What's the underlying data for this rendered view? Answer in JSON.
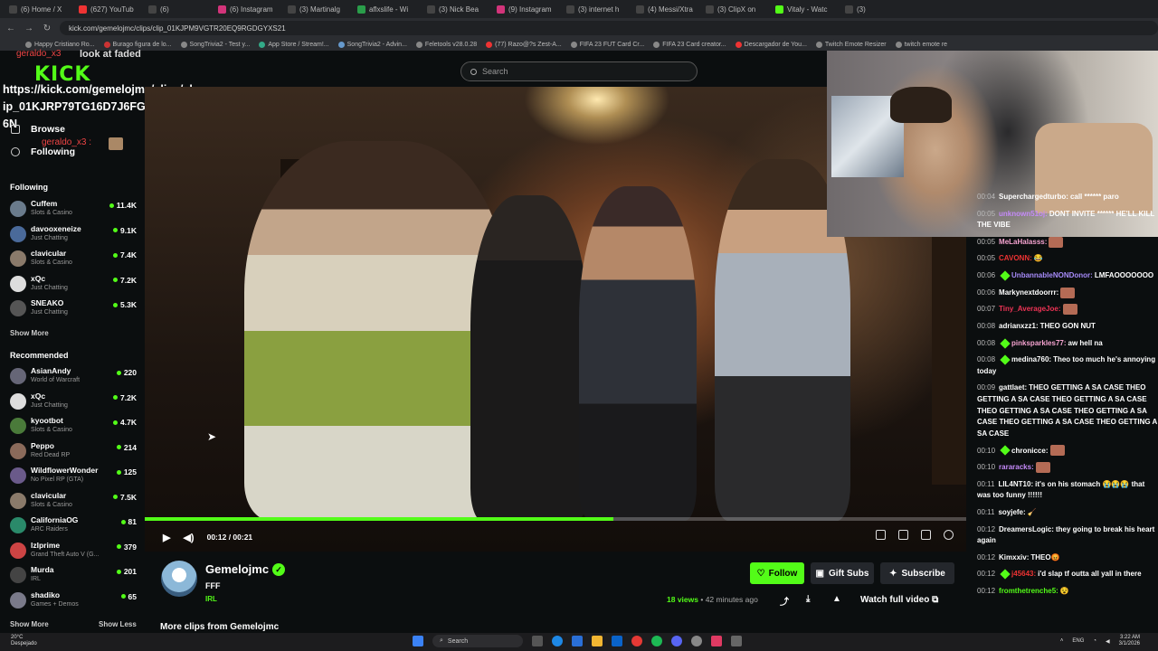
{
  "browser": {
    "tabs": [
      {
        "label": "(6) Home / X",
        "color": "#444"
      },
      {
        "label": "(627) YouTub",
        "color": "#e33"
      },
      {
        "label": "(6) ",
        "color": "#444"
      },
      {
        "label": "(6) Instagram",
        "color": "#d2347a"
      },
      {
        "label": "(3) Martinalg",
        "color": "#444"
      },
      {
        "label": "aflxslife - Wi",
        "color": "#2a9d4a"
      },
      {
        "label": "(3) Nick Bea",
        "color": "#444"
      },
      {
        "label": "(9) Instagram",
        "color": "#d2347a"
      },
      {
        "label": "(3) internet h",
        "color": "#444"
      },
      {
        "label": "(4) Messi/Xtra",
        "color": "#444"
      },
      {
        "label": "(3) ClipX on",
        "color": "#444"
      },
      {
        "label": "Vitaly - Watc",
        "color": "#53fc18"
      },
      {
        "label": "(3)",
        "color": "#444"
      }
    ],
    "url": "kick.com/gemelojmc/clips/clip_01KJPM9VGTR20EQ9RGDGYXS21",
    "bookmarks": [
      {
        "label": "Happy Cristiano Ro...",
        "color": "#888"
      },
      {
        "label": "Burago figura de lo...",
        "color": "#c33"
      },
      {
        "label": "SongTrivia2 - Test y...",
        "color": "#888"
      },
      {
        "label": "App Store / Stream!...",
        "color": "#3a8"
      },
      {
        "label": "SongTrivia2 - Advin...",
        "color": "#69c"
      },
      {
        "label": "Feletools v28.0.28",
        "color": "#888"
      },
      {
        "label": "(77) Razo@?s Zest-A...",
        "color": "#e33"
      },
      {
        "label": "FIFA 23 FUT Card Cr...",
        "color": "#888"
      },
      {
        "label": "FIFA 23 Card creator...",
        "color": "#888"
      },
      {
        "label": "Descargador de You...",
        "color": "#e33"
      },
      {
        "label": "Twitch Emote Resizer",
        "color": "#888"
      },
      {
        "label": "twitch emote re",
        "color": "#888"
      }
    ]
  },
  "overlay": {
    "chat_user": "geraldo_x3",
    "chat_msg": "look at faded",
    "link": "https://kick.com/gemelojmc/clips/clip_01KJRP79TG16D7J6FGRVYFH16N",
    "chat_user2": "geraldo_x3 :"
  },
  "logo": "KICK",
  "nav": {
    "browse": "Browse",
    "following": "Following"
  },
  "following": {
    "title": "Following",
    "channels": [
      {
        "name": "Cuffem",
        "category": "Slots & Casino",
        "viewers": "11.4K",
        "color": "#6a7b8c"
      },
      {
        "name": "davooxeneize",
        "category": "Just Chatting",
        "viewers": "9.1K",
        "color": "#4a6a9a"
      },
      {
        "name": "clavicular",
        "category": "Slots & Casino",
        "viewers": "7.4K",
        "color": "#8a7a6a"
      },
      {
        "name": "xQc",
        "category": "Just Chatting",
        "viewers": "7.2K",
        "color": "#ddd"
      },
      {
        "name": "SNEAKO",
        "category": "Just Chatting",
        "viewers": "5.3K",
        "color": "#555"
      }
    ],
    "show_more": "Show More"
  },
  "recommended": {
    "title": "Recommended",
    "channels": [
      {
        "name": "AsianAndy",
        "category": "World of Warcraft",
        "viewers": "220",
        "color": "#667"
      },
      {
        "name": "xQc",
        "category": "Just Chatting",
        "viewers": "7.2K",
        "color": "#ddd"
      },
      {
        "name": "kyootbot",
        "category": "Slots & Casino",
        "viewers": "4.7K",
        "color": "#4a7a3a"
      },
      {
        "name": "Peppo",
        "category": "Red Dead RP",
        "viewers": "214",
        "color": "#8a6a5a"
      },
      {
        "name": "WildflowerWonder",
        "category": "No Pixel RP (GTA)",
        "viewers": "125",
        "color": "#6a5a8a"
      },
      {
        "name": "clavicular",
        "category": "Slots & Casino",
        "viewers": "7.5K",
        "color": "#8a7a6a"
      },
      {
        "name": "CaliforniaOG",
        "category": "ARC Raiders",
        "viewers": "81",
        "color": "#2a8a6a"
      },
      {
        "name": "lzIprime",
        "category": "Grand Theft Auto V (G...",
        "viewers": "379",
        "color": "#c44"
      },
      {
        "name": "Murda",
        "category": "IRL",
        "viewers": "201",
        "color": "#444"
      },
      {
        "name": "shadiko",
        "category": "Games + Demos",
        "viewers": "65",
        "color": "#7a7a8a"
      }
    ],
    "show_more": "Show More",
    "show_less": "Show Less"
  },
  "search": {
    "placeholder": "Search"
  },
  "player": {
    "time": "00:12 / 00:21",
    "progress": 0.57,
    "accent": "#53fc18"
  },
  "channel": {
    "name": "Gemelojmc",
    "title": "FFF",
    "category": "IRL",
    "follow_label": "Follow",
    "gift_label": "Gift Subs",
    "subscribe_label": "Subscribe",
    "views": "18 views",
    "ago": "42 minutes ago",
    "watch_full": "Watch full video",
    "more_clips": "More clips from Gemelojmc"
  },
  "chat": [
    {
      "time": "00:04",
      "user": "Superchargedturbo:",
      "color": "#fff",
      "text": "call ****** paro"
    },
    {
      "time": "00:05",
      "user": "unknown51oj:",
      "color": "#c58af9",
      "text": "DONT INVITE ****** HE'LL KILL THE VIBE"
    },
    {
      "time": "00:05",
      "user": "MeLaHalasss:",
      "color": "#f5a3d0",
      "text": "",
      "emote": true
    },
    {
      "time": "00:05",
      "user": "CAVONN:",
      "color": "#e33",
      "text": "😂"
    },
    {
      "time": "00:06",
      "user": "UnbannableNONDonor:",
      "color": "#a78bfa",
      "text": "LMFAOOOOOOO",
      "badge": true
    },
    {
      "time": "00:06",
      "user": "Markynextdoorrr:",
      "color": "#fff",
      "text": "",
      "emote": true
    },
    {
      "time": "00:07",
      "user": "Tiny_AverageJoe:",
      "color": "#e35",
      "text": "",
      "emote": true
    },
    {
      "time": "00:08",
      "user": "adrianxzz1:",
      "color": "#fff",
      "text": "THEO GON NUT"
    },
    {
      "time": "00:08",
      "user": "pinksparkles77:",
      "color": "#f5a3d0",
      "text": "aw hell na",
      "badge": true
    },
    {
      "time": "00:08",
      "user": "medina760:",
      "color": "#fff",
      "text": "Theo too much he's annoying today",
      "badge": true
    },
    {
      "time": "00:09",
      "user": "gattlaet:",
      "color": "#fff",
      "text": "THEO GETTING A SA CASE THEO GETTING A SA CASE THEO GETTING A SA CASE THEO GETTING A SA CASE THEO GETTING A SA CASE THEO GETTING A SA CASE THEO GETTING A SA CASE"
    },
    {
      "time": "00:10",
      "user": "chronicce:",
      "color": "#fff",
      "text": "",
      "emote": true,
      "badge": true
    },
    {
      "time": "00:10",
      "user": "rararacks:",
      "color": "#c58af9",
      "text": "",
      "emote": true
    },
    {
      "time": "00:11",
      "user": "LIL4NT10:",
      "color": "#fff",
      "text": "it's on his stomach 😭😭😭 that was too funny !!!!!!"
    },
    {
      "time": "00:11",
      "user": "soyjefe:",
      "color": "#fff",
      "text": "🧹"
    },
    {
      "time": "00:12",
      "user": "DreamersLogic:",
      "color": "#fff",
      "text": "they going to break his heart again"
    },
    {
      "time": "00:12",
      "user": "Kimxxiv:",
      "color": "#fff",
      "text": "THEO😡"
    },
    {
      "time": "00:12",
      "user": "j45643:",
      "color": "#e33",
      "text": "i'd slap tf outta all yall in there",
      "badge": true
    },
    {
      "time": "00:12",
      "user": "fromthetrenche5:",
      "color": "#53fc18",
      "text": "😵"
    }
  ],
  "taskbar": {
    "weather_temp": "20°C",
    "weather_desc": "Despejado",
    "search": "Search",
    "lang": "ENG",
    "time": "3:22 AM",
    "date": "3/1/2026"
  }
}
